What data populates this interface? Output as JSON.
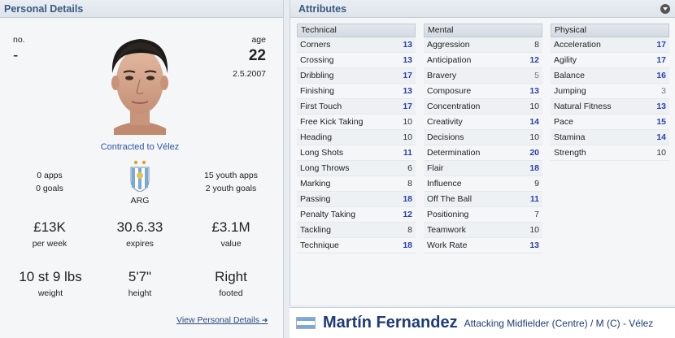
{
  "personal": {
    "title": "Personal Details",
    "no_label": "no.",
    "no_value": "-",
    "age_label": "age",
    "age_value": "22",
    "dob": "2.5.2007",
    "contract": "Contracted to Vélez",
    "apps": "0 apps",
    "goals": "0 goals",
    "nation": "ARG",
    "youth_apps": "15 youth apps",
    "youth_goals": "2 youth goals",
    "wage": "£13K",
    "wage_label": "per week",
    "expires": "30.6.33",
    "expires_label": "expires",
    "value": "£3.1M",
    "value_label": "value",
    "weight": "10 st 9 lbs",
    "weight_label": "weight",
    "height": "5'7\"",
    "height_label": "height",
    "footed": "Right",
    "footed_label": "footed",
    "view_link": "View Personal Details"
  },
  "attributes": {
    "title": "Attributes",
    "technical": {
      "header": "Technical",
      "items": [
        {
          "name": "Corners",
          "value": "13"
        },
        {
          "name": "Crossing",
          "value": "13"
        },
        {
          "name": "Dribbling",
          "value": "17"
        },
        {
          "name": "Finishing",
          "value": "13"
        },
        {
          "name": "First Touch",
          "value": "17"
        },
        {
          "name": "Free Kick Taking",
          "value": "10"
        },
        {
          "name": "Heading",
          "value": "10"
        },
        {
          "name": "Long Shots",
          "value": "11"
        },
        {
          "name": "Long Throws",
          "value": "6"
        },
        {
          "name": "Marking",
          "value": "8"
        },
        {
          "name": "Passing",
          "value": "18"
        },
        {
          "name": "Penalty Taking",
          "value": "12"
        },
        {
          "name": "Tackling",
          "value": "8"
        },
        {
          "name": "Technique",
          "value": "18"
        }
      ]
    },
    "mental": {
      "header": "Mental",
      "items": [
        {
          "name": "Aggression",
          "value": "8"
        },
        {
          "name": "Anticipation",
          "value": "12"
        },
        {
          "name": "Bravery",
          "value": "5"
        },
        {
          "name": "Composure",
          "value": "13"
        },
        {
          "name": "Concentration",
          "value": "10"
        },
        {
          "name": "Creativity",
          "value": "14"
        },
        {
          "name": "Decisions",
          "value": "10"
        },
        {
          "name": "Determination",
          "value": "20"
        },
        {
          "name": "Flair",
          "value": "18"
        },
        {
          "name": "Influence",
          "value": "9"
        },
        {
          "name": "Off The Ball",
          "value": "11"
        },
        {
          "name": "Positioning",
          "value": "7"
        },
        {
          "name": "Teamwork",
          "value": "10"
        },
        {
          "name": "Work Rate",
          "value": "13"
        }
      ]
    },
    "physical": {
      "header": "Physical",
      "items": [
        {
          "name": "Acceleration",
          "value": "17"
        },
        {
          "name": "Agility",
          "value": "17"
        },
        {
          "name": "Balance",
          "value": "16"
        },
        {
          "name": "Jumping",
          "value": "3"
        },
        {
          "name": "Natural Fitness",
          "value": "13"
        },
        {
          "name": "Pace",
          "value": "15"
        },
        {
          "name": "Stamina",
          "value": "14"
        },
        {
          "name": "Strength",
          "value": "10"
        }
      ]
    }
  },
  "player_bar": {
    "name": "Martín Fernandez",
    "position": "Attacking Midfielder (Centre) / M (C) - Vélez"
  },
  "colors": {
    "high": "#2a3fb0",
    "link": "#2f55a4",
    "header_text": "#3a5a80"
  }
}
